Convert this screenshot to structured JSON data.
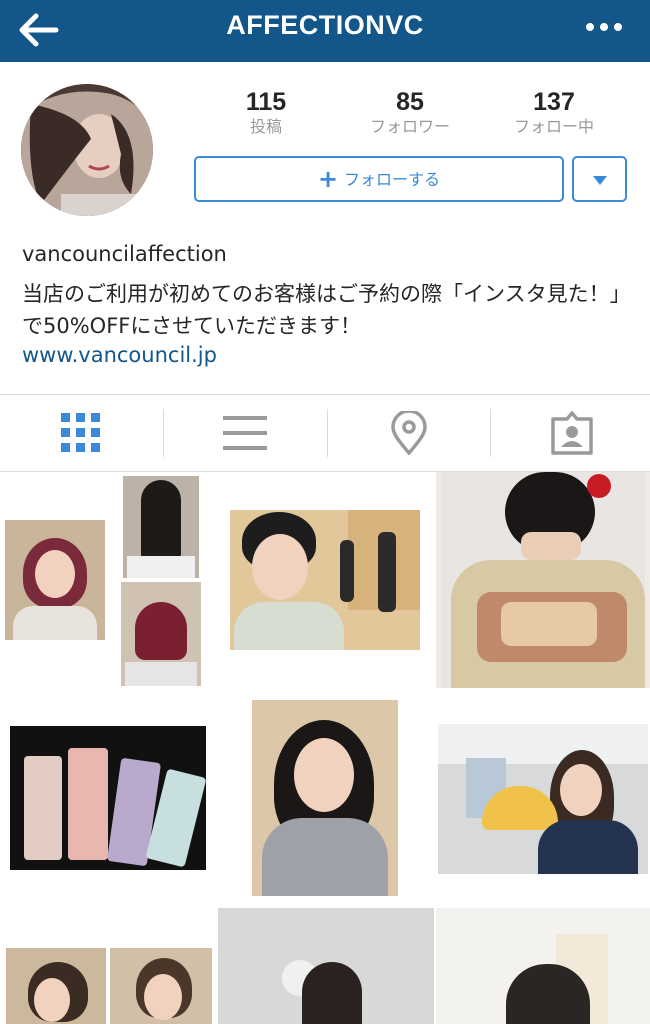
{
  "header": {
    "title": "AFFECTIONVC",
    "back_icon": "arrow-left-icon",
    "more_icon": "more-dots-icon",
    "bg_color": "#12568a"
  },
  "profile": {
    "username": "vancouncilaffection",
    "bio": "当店のご利用が初めてのお客様はご予約の際「インスタ見た！」で50%OFFにさせていただきます！",
    "website": "www.vancouncil.jp",
    "stats": [
      {
        "value": "115",
        "label": "投稿"
      },
      {
        "value": "85",
        "label": "フォロワー"
      },
      {
        "value": "137",
        "label": "フォロー中"
      }
    ],
    "follow_button": "フォローする",
    "accent_color": "#3b8ad8"
  },
  "tabs": [
    {
      "name": "grid-view",
      "icon": "grid-icon",
      "active": true
    },
    {
      "name": "list-view",
      "icon": "list-icon",
      "active": false
    },
    {
      "name": "location",
      "icon": "location-pin-icon",
      "active": false
    },
    {
      "name": "tagged",
      "icon": "tagged-person-icon",
      "active": false
    }
  ]
}
